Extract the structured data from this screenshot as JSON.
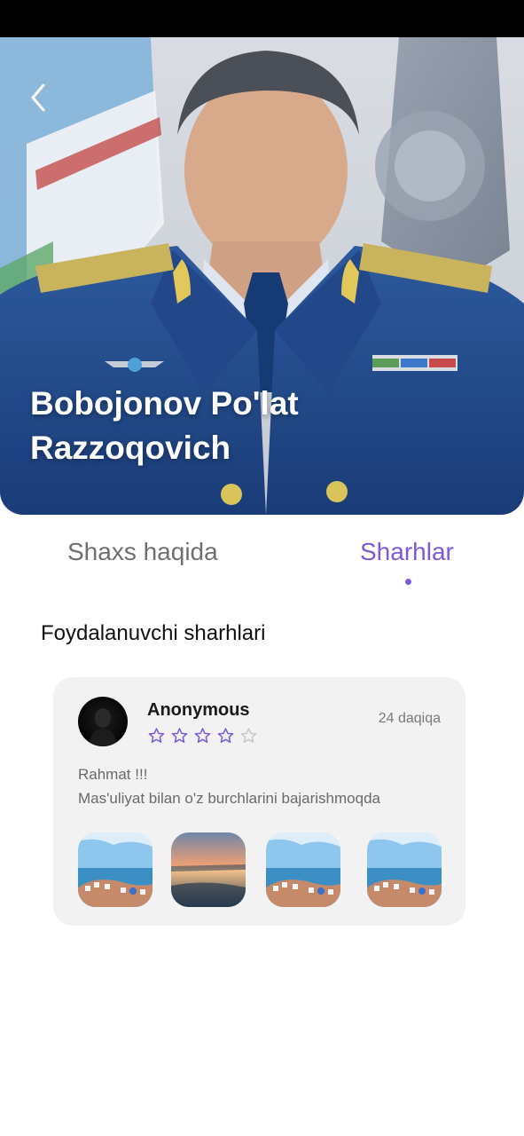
{
  "profile": {
    "name_line1": "Bobojonov Po'lat",
    "name_line2": "Razzoqovich"
  },
  "icons": {
    "back": "chevron-left-icon",
    "star_filled": "star-outline-purple-icon",
    "star_empty": "star-outline-gray-icon"
  },
  "tabs": [
    {
      "label": "Shaxs haqida",
      "active": false
    },
    {
      "label": "Sharhlar",
      "active": true
    }
  ],
  "section": {
    "title": "Foydalanuvchi sharhlari"
  },
  "comment": {
    "author": "Anonymous",
    "rating": 4,
    "rating_max": 5,
    "time": "24 daqiqa",
    "text_line1": "Rahmat !!!",
    "text_line2": "Mas'uliyat bilan o'z burchlarini bajarishmoqda",
    "photos": [
      "coastal-town-photo",
      "sunset-sea-photo",
      "coastal-town-photo",
      "coastal-town-photo"
    ]
  },
  "colors": {
    "accent": "#7a5ad8",
    "card_background": "#f2f2f2",
    "inactive_tab": "#6f6f6f",
    "status_bar": "#000000"
  }
}
